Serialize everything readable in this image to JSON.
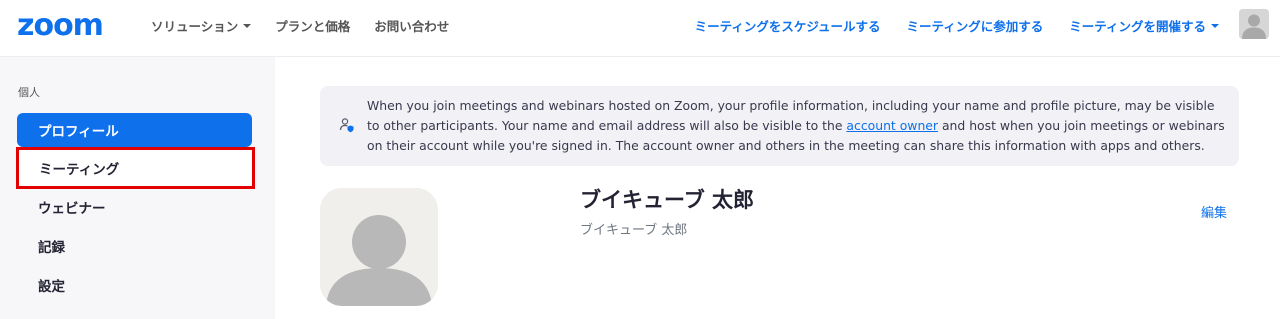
{
  "header": {
    "logo": "zoom",
    "nav_left": [
      {
        "label": "ソリューション",
        "has_caret": true
      },
      {
        "label": "プランと価格",
        "has_caret": false
      },
      {
        "label": "お問い合わせ",
        "has_caret": false
      }
    ],
    "nav_right": [
      {
        "label": "ミーティングをスケジュールする"
      },
      {
        "label": "ミーティングに参加する"
      },
      {
        "label": "ミーティングを開催する",
        "has_caret": true
      }
    ]
  },
  "sidebar": {
    "section_label": "個人",
    "items": [
      {
        "label": "プロフィール",
        "state": "active"
      },
      {
        "label": "ミーティング",
        "state": "highlighted"
      },
      {
        "label": "ウェビナー",
        "state": "normal"
      },
      {
        "label": "記録",
        "state": "normal"
      },
      {
        "label": "設定",
        "state": "normal"
      }
    ]
  },
  "notice": {
    "text_before_link": "When you join meetings and webinars hosted on Zoom, your profile information, including your name and profile picture, may be visible to other participants. Your name and email address will also be visible to the ",
    "link_text": "account owner",
    "text_after_link": " and host when you join meetings or webinars on their account while you're signed in. The account owner and others in the meeting can share this information with apps and others."
  },
  "profile": {
    "name": "ブイキューブ 太郎",
    "sub_name": "ブイキューブ 太郎",
    "edit_label": "編集"
  },
  "colors": {
    "accent": "#0e71eb",
    "highlight_border": "#e30000",
    "sidebar_bg": "#f7f7fa",
    "notice_bg": "#f1f1f6"
  }
}
